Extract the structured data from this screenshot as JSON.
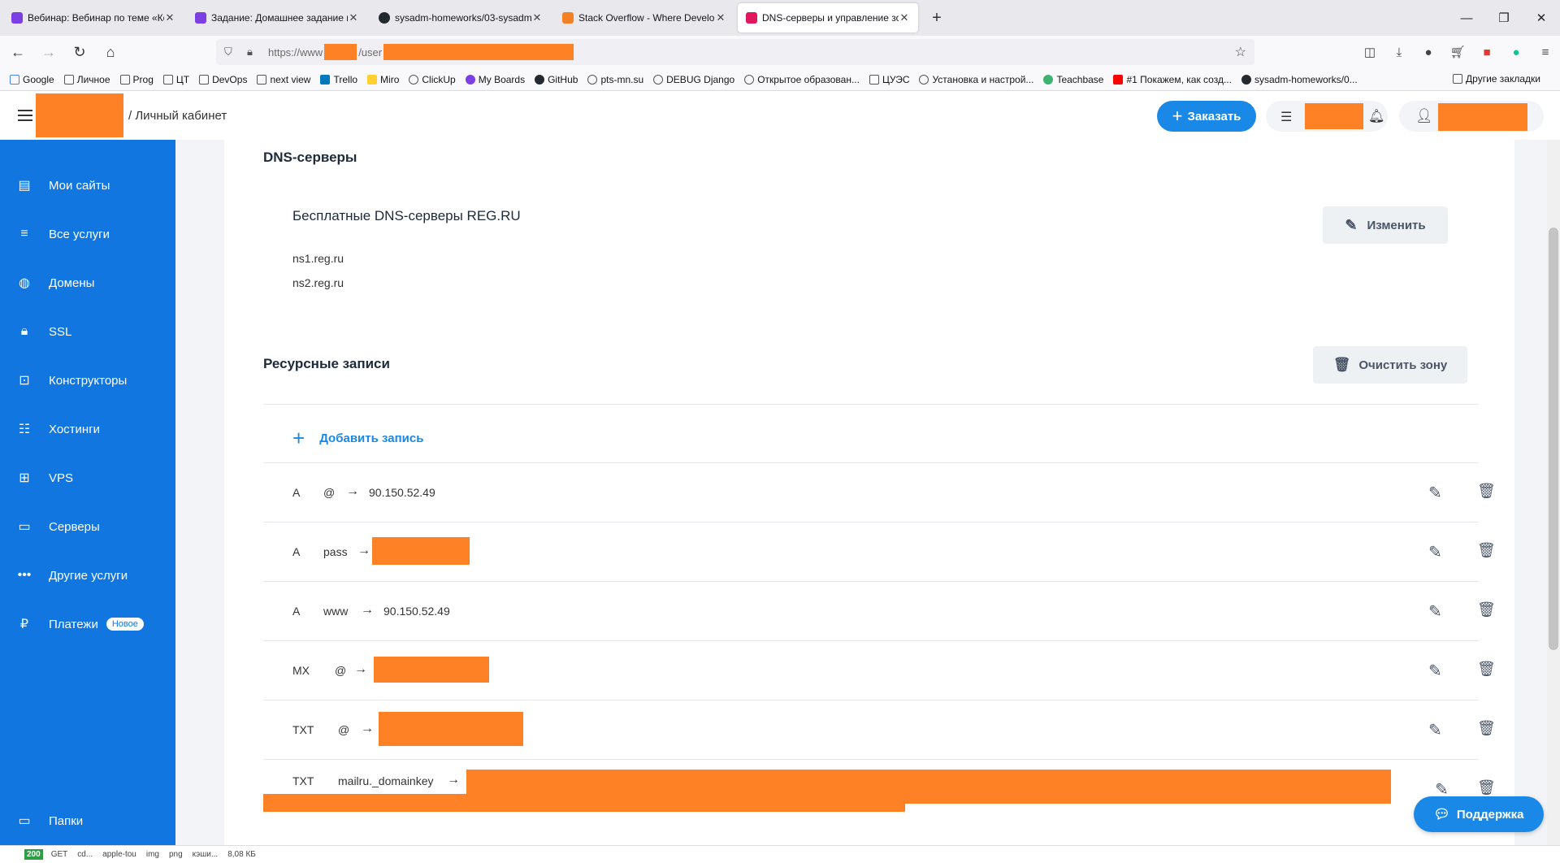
{
  "browser": {
    "tabs": [
      {
        "title": "Вебинар: Вебинар по теме «Ко",
        "color": "#7b3fe4"
      },
      {
        "title": "Задание: Домашнее задание п",
        "color": "#7b3fe4"
      },
      {
        "title": "sysadm-homeworks/03-sysadm",
        "color": "#24292f"
      },
      {
        "title": "Stack Overflow - Where Develop",
        "color": "#f48024"
      },
      {
        "title": "DNS-серверы и управление зо",
        "color": "#e0175d"
      }
    ],
    "url_prefix": "https://www",
    "url_mid": "/user",
    "bookmarks": [
      "Google",
      "Личное",
      "Prog",
      "ЦТ",
      "DevOps",
      "next view",
      "Trello",
      "Miro",
      "ClickUp",
      "My Boards",
      "GitHub",
      "pts-mn.su",
      "DEBUG Django",
      "Открытое образован...",
      "ЦУЭС",
      "Установка и настрой...",
      "Teachbase",
      "#1 Покажем, как созд...",
      "sysadm-homeworks/0..."
    ],
    "other_bookmarks": "Другие закладки"
  },
  "header": {
    "breadcrumb": "/ Личный кабинет",
    "order_label": "Заказать"
  },
  "sidebar": {
    "items": [
      {
        "label": "Мои сайты",
        "icon": "sites-icon"
      },
      {
        "label": "Все услуги",
        "icon": "list-icon"
      },
      {
        "label": "Домены",
        "icon": "globe-icon"
      },
      {
        "label": "SSL",
        "icon": "ssl-icon"
      },
      {
        "label": "Конструкторы",
        "icon": "builder-icon"
      },
      {
        "label": "Хостинги",
        "icon": "hosting-icon"
      },
      {
        "label": "VPS",
        "icon": "vps-icon"
      },
      {
        "label": "Серверы",
        "icon": "server-icon"
      },
      {
        "label": "Другие услуги",
        "icon": "dots-icon"
      },
      {
        "label": "Платежи",
        "icon": "ruble-icon"
      }
    ],
    "payments_badge": "Новое",
    "folders_label": "Папки"
  },
  "dns": {
    "title": "DNS-серверы",
    "free_title": "Бесплатные DNS-серверы REG.RU",
    "servers": [
      "ns1.reg.ru",
      "ns2.reg.ru"
    ],
    "change_label": "Изменить"
  },
  "records": {
    "title": "Ресурсные записи",
    "clear_label": "Очистить зону",
    "add_label": "Добавить запись",
    "arrow": "→",
    "rows": [
      {
        "type": "A",
        "host": "@",
        "value": "90.150.52.49"
      },
      {
        "type": "A",
        "host": "pass",
        "value": ""
      },
      {
        "type": "A",
        "host": "www",
        "value": "90.150.52.49"
      },
      {
        "type": "MX",
        "host": "@",
        "value": ""
      },
      {
        "type": "TXT",
        "host": "@",
        "value": ""
      },
      {
        "type": "TXT",
        "host": "mailru._domainkey",
        "value": ""
      }
    ]
  },
  "support_label": "Поддержка",
  "statusbar": {
    "code": "200",
    "method": "GET",
    "domain": "cd...",
    "file": "apple-tou",
    "cause": "img",
    "type": "png",
    "transferred": "кэши...",
    "size": "8,08 КБ"
  },
  "colors": {
    "accent": "#1988e6",
    "sidebar": "#1176e0",
    "redaction": "#fe8126"
  }
}
